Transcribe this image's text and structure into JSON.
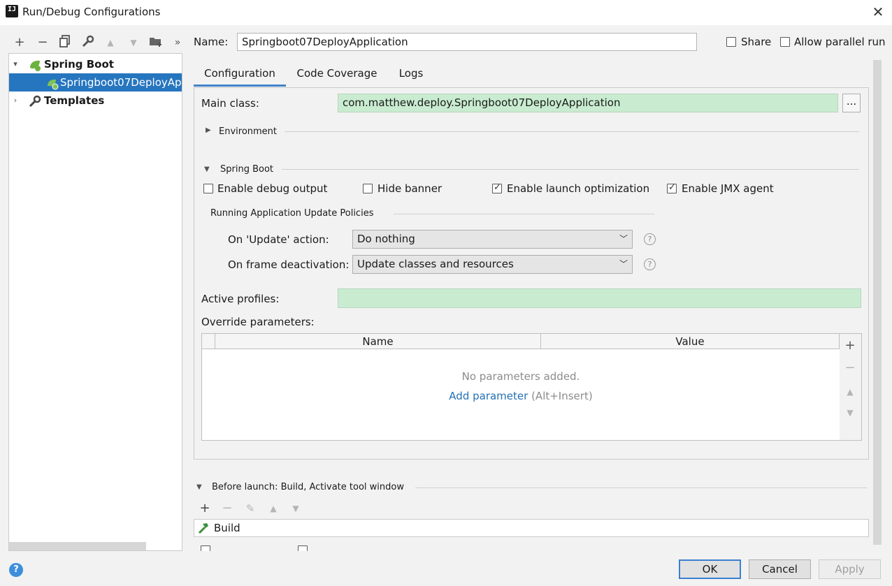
{
  "window": {
    "title": "Run/Debug Configurations",
    "close_icon": "close-icon",
    "app_logo": "IJ"
  },
  "toolbar": {
    "add": "+",
    "remove": "−",
    "copy": "⧉",
    "edit_defaults": "🔧",
    "move_up": "▲",
    "move_down": "▼",
    "new_folder": "📁",
    "more": "»"
  },
  "tree": {
    "items": [
      {
        "label": "Spring Boot",
        "expanded": true,
        "bold": true,
        "icon": "spring-boot-icon"
      },
      {
        "label": "Springboot07DeployApplication",
        "selected": true,
        "icon": "spring-boot-run-icon"
      },
      {
        "label": "Templates",
        "expanded": false,
        "bold": true,
        "icon": "wrench-icon"
      }
    ]
  },
  "header": {
    "name_label": "Name:",
    "name_value": "Springboot07DeployApplication",
    "share_label": "Share",
    "allow_parallel_label": "Allow parallel run"
  },
  "tabs": [
    {
      "label": "Configuration",
      "active": true
    },
    {
      "label": "Code Coverage",
      "active": false
    },
    {
      "label": "Logs",
      "active": false
    }
  ],
  "config": {
    "main_class_label": "Main class:",
    "main_class_value": "com.matthew.deploy.Springboot07DeployApplication",
    "browse_label": "...",
    "environment_label": "Environment",
    "spring_boot_label": "Spring Boot",
    "options": [
      {
        "label": "Enable debug output",
        "checked": false
      },
      {
        "label": "Hide banner",
        "checked": false
      },
      {
        "label": "Enable launch optimization",
        "checked": true
      },
      {
        "label": "Enable JMX agent",
        "checked": true
      }
    ],
    "policies_label": "Running Application Update Policies",
    "update_action_label": "On 'Update' action:",
    "update_action_value": "Do nothing",
    "frame_deactivation_label": "On frame deactivation:",
    "frame_deactivation_value": "Update classes and resources",
    "active_profiles_label": "Active profiles:",
    "active_profiles_value": "",
    "override_label": "Override parameters:",
    "table": {
      "columns": [
        "Name",
        "Value"
      ],
      "empty_text": "No parameters added.",
      "add_link": "Add parameter",
      "add_shortcut": "(Alt+Insert)"
    }
  },
  "before_launch": {
    "label": "Before launch: Build, Activate tool window",
    "tasks": [
      "Build"
    ]
  },
  "buttons": {
    "ok": "OK",
    "cancel": "Cancel",
    "apply": "Apply"
  },
  "help": "?",
  "colors": {
    "selection": "#2675bf",
    "green_field": "#c9ecd1",
    "link": "#2470b3",
    "tab_underline": "#4083c9"
  }
}
